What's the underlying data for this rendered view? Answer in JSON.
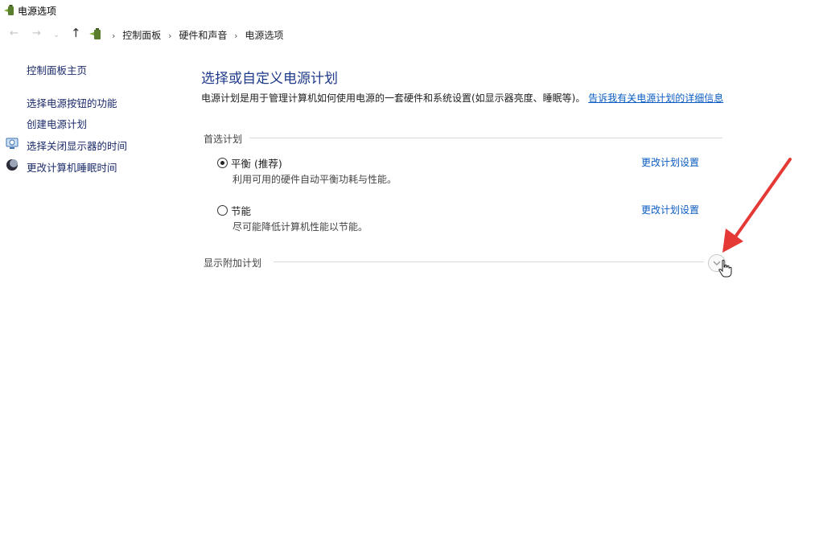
{
  "window": {
    "title": "电源选项",
    "icon": "power-options-icon"
  },
  "nav": {
    "back_icon": "←",
    "forward_icon": "→",
    "dropdown_icon": "⌄",
    "up_icon": "↑",
    "breadcrumbs": [
      "控制面板",
      "硬件和声音",
      "电源选项"
    ],
    "separator": "›"
  },
  "sidebar": {
    "home": "控制面板主页",
    "links": [
      {
        "label": "选择电源按钮的功能",
        "icon": ""
      },
      {
        "label": "创建电源计划",
        "icon": ""
      },
      {
        "label": "选择关闭显示器的时间",
        "icon": "monitor-icon"
      },
      {
        "label": "更改计算机睡眠时间",
        "icon": "sleep-moon-icon"
      }
    ]
  },
  "main": {
    "heading": "选择或自定义电源计划",
    "description": "电源计划是用于管理计算机如何使用电源的一套硬件和系统设置(如显示器亮度、睡眠等)。",
    "description_link": "告诉我有关电源计划的详细信息",
    "preferred_group": "首选计划",
    "plans": [
      {
        "name": "平衡 (推荐)",
        "description": "利用可用的硬件自动平衡功耗与性能。",
        "selected": true,
        "link": "更改计划设置"
      },
      {
        "name": "节能",
        "description": "尽可能降低计算机性能以节能。",
        "selected": false,
        "link": "更改计划设置"
      }
    ],
    "additional_group": "显示附加计划"
  },
  "colors": {
    "link": "#0b5cc2",
    "heading": "#1e3a8a",
    "sidebar_link": "#1c2b6b",
    "annotation_arrow": "#e53935"
  }
}
